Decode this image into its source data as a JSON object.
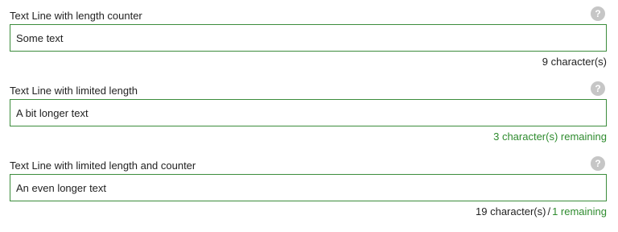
{
  "fields": [
    {
      "label": "Text Line with length counter",
      "value": "Some text",
      "counter": "9 character(s)"
    },
    {
      "label": "Text Line with limited length",
      "value": "A bit longer text",
      "remaining": "3 character(s) remaining"
    },
    {
      "label": "Text Line with limited length and counter",
      "value": "An even longer text",
      "counter": "19 character(s)",
      "separator": "/",
      "remaining": "1 remaining"
    }
  ],
  "help_icon_glyph": "?",
  "colors": {
    "input_border": "#3c8c3c",
    "remaining_text": "#2e8b2e",
    "help_icon_bg": "#c6c6c6"
  },
  "icons": {
    "help": "help-icon"
  }
}
